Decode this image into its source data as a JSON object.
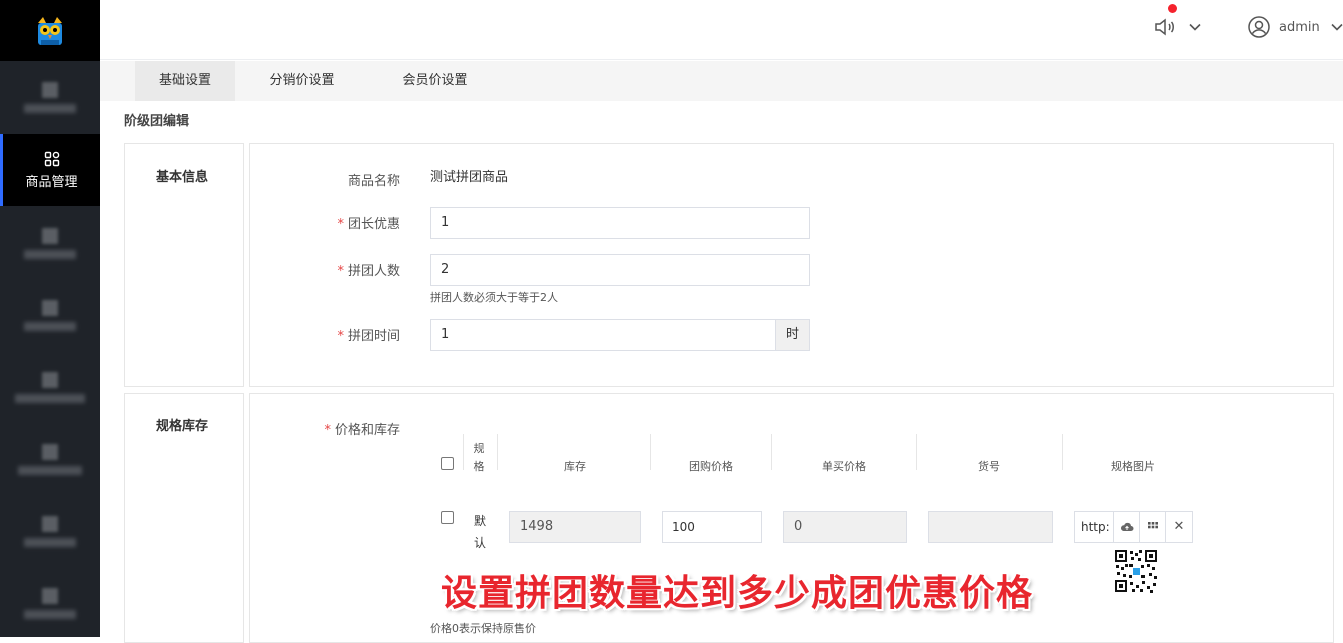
{
  "header": {
    "username": "admin"
  },
  "sidebar": {
    "active_label": "商品管理"
  },
  "tabs": [
    {
      "label": "基础设置"
    },
    {
      "label": "分销价设置"
    },
    {
      "label": "会员价设置"
    }
  ],
  "breadcrumb": "阶级团编辑",
  "basic_info": {
    "title": "基本信息",
    "product_name_label": "商品名称",
    "product_name_value": "测试拼团商品",
    "leader_discount_label": "团长优惠",
    "leader_discount_value": "1",
    "group_size_label": "拼团人数",
    "group_size_value": "2",
    "group_size_hint": "拼团人数必须大于等于2人",
    "group_time_label": "拼团时间",
    "group_time_value": "1",
    "group_time_unit": "时"
  },
  "spec": {
    "title": "规格库存",
    "price_stock_label": "价格和库存",
    "columns": [
      "规格",
      "库存",
      "团购价格",
      "单买价格",
      "货号",
      "规格图片"
    ],
    "row": {
      "spec": "默认",
      "stock": "1498",
      "group_price": "100",
      "single_price": "0",
      "sku": "",
      "image_url": "http:"
    },
    "price_hint": "价格0表示保持原售价"
  },
  "overlay_caption": "设置拼团数量达到多少成团优惠价格",
  "colors": {
    "accent": "#2f6bff",
    "required": "#e54545",
    "caption": "#e8262e"
  }
}
